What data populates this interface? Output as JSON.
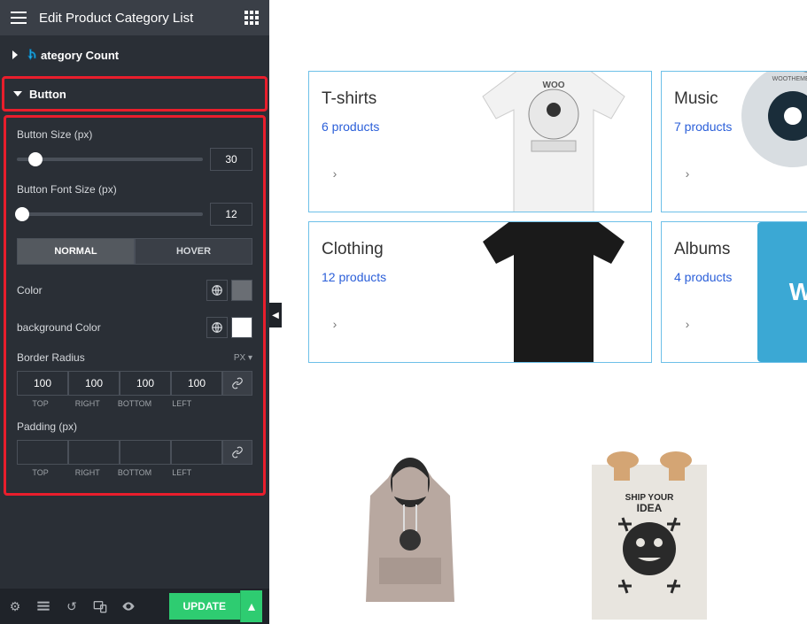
{
  "topbar": {
    "title": "Edit Product Category List"
  },
  "sections": {
    "category_count": "ategory Count",
    "button": "Button"
  },
  "fields": {
    "button_size": {
      "label": "Button Size (px)",
      "value": "30",
      "thumb_pct": 10
    },
    "button_font_size": {
      "label": "Button Font Size (px)",
      "value": "12",
      "thumb_pct": 3
    }
  },
  "tabs": {
    "normal": "NORMAL",
    "hover": "HOVER"
  },
  "colors": {
    "color_label": "Color",
    "bg_label": "background Color",
    "color_swatch": "#6a6e74",
    "bg_swatch": "#ffffff"
  },
  "border_radius": {
    "label": "Border Radius",
    "unit": "PX",
    "top": "100",
    "right": "100",
    "bottom": "100",
    "left": "100",
    "lbl_top": "TOP",
    "lbl_right": "RIGHT",
    "lbl_bottom": "BOTTOM",
    "lbl_left": "LEFT"
  },
  "padding": {
    "label": "Padding (px)",
    "top": "",
    "right": "",
    "bottom": "",
    "left": "",
    "lbl_top": "TOP",
    "lbl_right": "RIGHT",
    "lbl_bottom": "BOTTOM",
    "lbl_left": "LEFT"
  },
  "bottombar": {
    "update": "UPDATE"
  },
  "preview": {
    "cards": [
      {
        "title": "T-shirts",
        "count": "6 products"
      },
      {
        "title": "Music",
        "count": "7 products"
      },
      {
        "title": "Clothing",
        "count": "12 products"
      },
      {
        "title": "Albums",
        "count": "4 products"
      }
    ]
  }
}
